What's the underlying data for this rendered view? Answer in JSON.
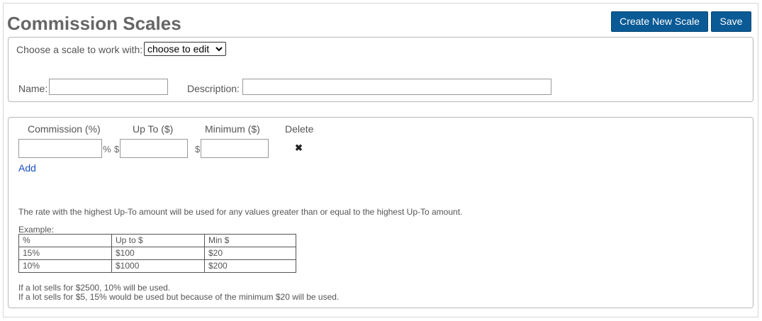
{
  "header": {
    "title": "Commission Scales",
    "create_label": "Create New Scale",
    "save_label": "Save"
  },
  "scale_picker": {
    "label": "Choose a scale to work with:",
    "selected": "choose to edit"
  },
  "form": {
    "name_label": "Name:",
    "name_value": "",
    "description_label": "Description:",
    "description_value": ""
  },
  "rates": {
    "headers": {
      "commission": "Commission (%)",
      "up_to": "Up To ($)",
      "minimum": "Minimum ($)",
      "delete": "Delete"
    },
    "percent_symbol": "%",
    "dollar_symbol": "$",
    "delete_glyph": "✖",
    "add_label": "Add"
  },
  "help": {
    "note": "The rate with the highest Up-To amount will be used for any values greater than or equal to the highest Up-To amount.",
    "example_label": "Example:",
    "table": {
      "headers": [
        "%",
        "Up to $",
        "Min $"
      ],
      "rows": [
        [
          "15%",
          "$100",
          "$20"
        ],
        [
          "10%",
          "$1000",
          "$200"
        ]
      ]
    },
    "footnote_1": "If a lot sells for $2500, 10% will be used.",
    "footnote_2": "If a lot sells for $5, 15% would be used but because of the minimum $20 will be used."
  },
  "colors": {
    "button": "#0a5a96",
    "link": "#1a4fc7",
    "title": "#666666"
  }
}
